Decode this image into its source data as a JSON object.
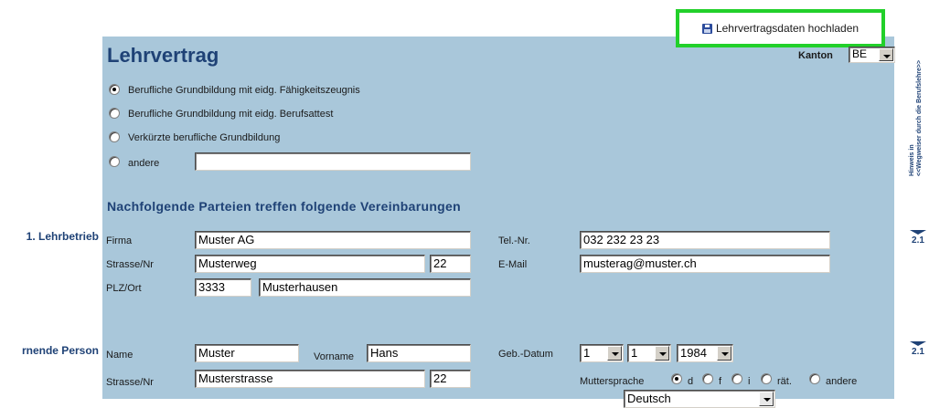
{
  "upload_link": {
    "label": "Lehrvertragsdaten hochladen",
    "icon": "save-icon"
  },
  "header": {
    "title": "Lehrvertrag",
    "kanton_label": "Kanton",
    "kanton_value": "BE"
  },
  "sidebar": {
    "hint_line1": "Hinweis in",
    "hint_line2": "<<Wegweiser durch die Berufslehre>>",
    "marker1": "2.1",
    "marker2": "2.1"
  },
  "training_type": {
    "options": [
      {
        "label": "Berufliche Grundbildung mit eidg. Fähigkeitszeugnis",
        "selected": true
      },
      {
        "label": "Berufliche Grundbildung mit eidg. Berufsattest",
        "selected": false
      },
      {
        "label": "Verkürzte berufliche Grundbildung",
        "selected": false
      },
      {
        "label": "andere",
        "selected": false
      }
    ],
    "other_value": ""
  },
  "section_title": "Nachfolgende Parteien treffen folgende Vereinbarungen",
  "company": {
    "side_label": "1. Lehrbetrieb",
    "firma_label": "Firma",
    "firma": "Muster AG",
    "street_label": "Strasse/Nr",
    "street": "Musterweg",
    "street_no": "22",
    "plz_label": "PLZ/Ort",
    "plz": "3333",
    "ort": "Musterhausen",
    "tel_label": "Tel.-Nr.",
    "tel": "032 232 23 23",
    "email_label": "E-Mail",
    "email": "musterag@muster.ch"
  },
  "learner": {
    "side_label": "rnende Person",
    "name_label": "Name",
    "name": "Muster",
    "vorname_label": "Vorname",
    "vorname": "Hans",
    "street_label": "Strasse/Nr",
    "street": "Musterstrasse",
    "street_no": "22",
    "dob_label": "Geb.-Datum",
    "dob_day": "1",
    "dob_month": "1",
    "dob_year": "1984",
    "language_label": "Muttersprache",
    "languages": [
      {
        "label": "d",
        "selected": true
      },
      {
        "label": "f",
        "selected": false
      },
      {
        "label": "i",
        "selected": false
      },
      {
        "label": "rät.",
        "selected": false
      },
      {
        "label": "andere",
        "selected": false
      }
    ],
    "language_other": "Deutsch"
  }
}
